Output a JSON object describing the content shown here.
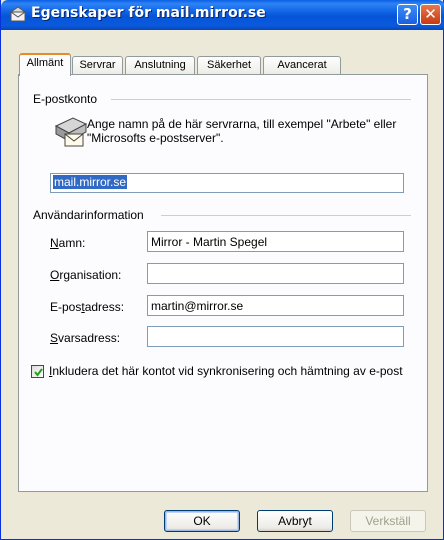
{
  "window": {
    "title": "Egenskaper för mail.mirror.se",
    "help_glyph": "?",
    "close_glyph": "✕"
  },
  "tabs": [
    {
      "label": "Allmänt",
      "active": true
    },
    {
      "label": "Servrar",
      "active": false
    },
    {
      "label": "Anslutning",
      "active": false
    },
    {
      "label": "Säkerhet",
      "active": false
    },
    {
      "label": "Avancerat",
      "active": false
    }
  ],
  "account": {
    "group_label": "E-postkonto",
    "description": "Ange namn på de här servrarna, till exempel \"Arbete\" eller \"Microsofts e-postserver\".",
    "name_value": "mail.mirror.se"
  },
  "user_info": {
    "group_label": "Användarinformation",
    "fields": [
      {
        "label_pre": "",
        "label_ul": "N",
        "label_post": "amn:",
        "value": "Mirror - Martin Spegel"
      },
      {
        "label_pre": "",
        "label_ul": "O",
        "label_post": "rganisation:",
        "value": ""
      },
      {
        "label_pre": "E-pos",
        "label_ul": "t",
        "label_post": "adress:",
        "value": "martin@mirror.se"
      },
      {
        "label_pre": "",
        "label_ul": "S",
        "label_post": "varsadress:",
        "value": ""
      }
    ]
  },
  "include_checkbox": {
    "checked": true,
    "label_ul": "I",
    "label_rest": "nkludera det här kontot vid synkronisering och hämtning av e-post"
  },
  "buttons": {
    "ok": "OK",
    "cancel": "Avbryt",
    "apply": "Verkställ"
  },
  "icons": {
    "title": "mail-account-icon",
    "server": "mail-server-icon",
    "check": "checkmark-icon"
  }
}
